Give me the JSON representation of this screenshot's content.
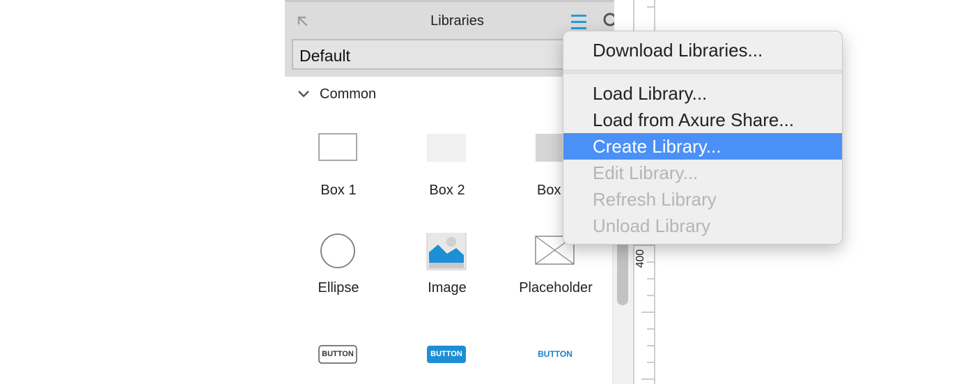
{
  "panel": {
    "title": "Libraries",
    "selected_library": "Default",
    "section_label": "Common"
  },
  "widgets": [
    {
      "label": "Box 1"
    },
    {
      "label": "Box 2"
    },
    {
      "label": "Box"
    },
    {
      "label": "Ellipse"
    },
    {
      "label": "Image"
    },
    {
      "label": "Placeholder"
    },
    {
      "label": "BUTTON"
    },
    {
      "label": "BUTTON"
    },
    {
      "label": "BUTTON"
    }
  ],
  "ruler": {
    "label": "400"
  },
  "menu": {
    "items": [
      {
        "label": "Download Libraries...",
        "state": "enabled"
      },
      {
        "label": "Load Library...",
        "state": "enabled"
      },
      {
        "label": "Load from Axure Share...",
        "state": "enabled"
      },
      {
        "label": "Create Library...",
        "state": "highlighted"
      },
      {
        "label": "Edit Library...",
        "state": "disabled"
      },
      {
        "label": "Refresh Library",
        "state": "disabled"
      },
      {
        "label": "Unload Library",
        "state": "disabled"
      }
    ]
  },
  "colors": {
    "accent": "#4a90f7",
    "menu_icon": "#2a9ad6",
    "image_blue": "#1d8fd4",
    "button_blue": "#1d8fd4"
  },
  "icons": {
    "pop_out": "pop-out-arrow-icon",
    "menu": "hamburger-menu-icon",
    "search": "search-icon",
    "section": "chevron-down-icon"
  }
}
